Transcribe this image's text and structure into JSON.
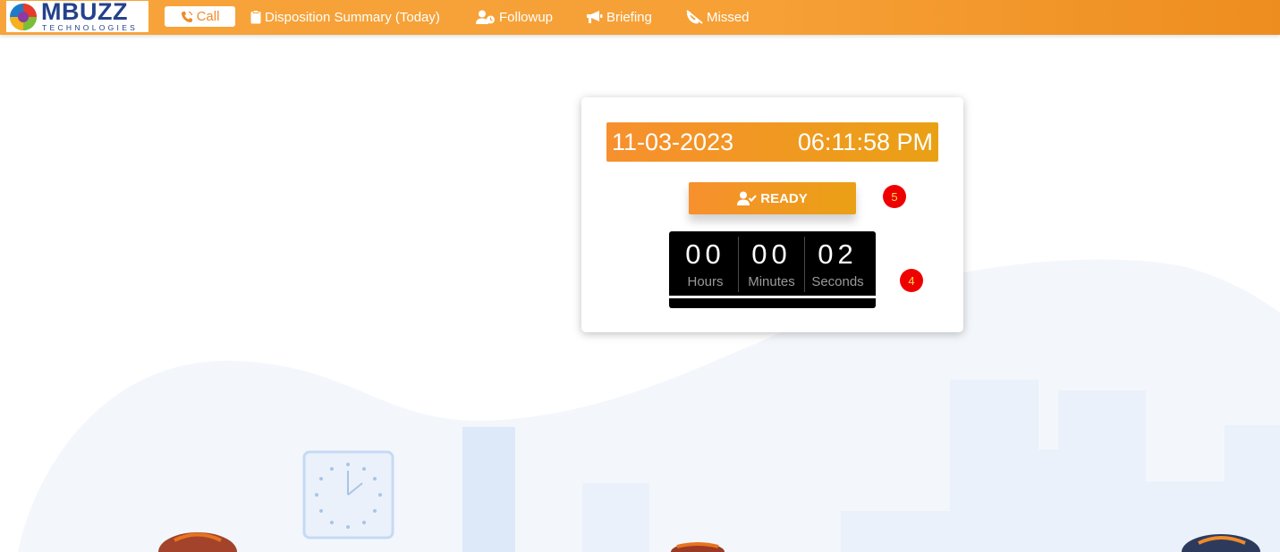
{
  "brand": {
    "name": "MBUZZ",
    "tagline": "TECHNOLOGIES"
  },
  "nav": {
    "call": "Call",
    "disposition": "Disposition Summary (Today)",
    "followup": "Followup",
    "briefing": "Briefing",
    "missed": "Missed"
  },
  "status": {
    "date": "11-03-2023",
    "time": "06:11:58 PM",
    "ready_label": "READY",
    "ready_badge": "5",
    "timer_badge": "4"
  },
  "timer": {
    "hours": "00",
    "hours_label": "Hours",
    "minutes": "00",
    "minutes_label": "Minutes",
    "seconds": "02",
    "seconds_label": "Seconds"
  },
  "colors": {
    "accent": "#f7902e",
    "brand_blue": "#24418c",
    "badge_red": "#ee0000",
    "bg_blue": "#eef4fb"
  },
  "icons": [
    "phone-icon",
    "clipboard-icon",
    "user-clock-icon",
    "megaphone-icon",
    "missed-call-icon",
    "user-check-icon",
    "wall-clock-icon"
  ]
}
